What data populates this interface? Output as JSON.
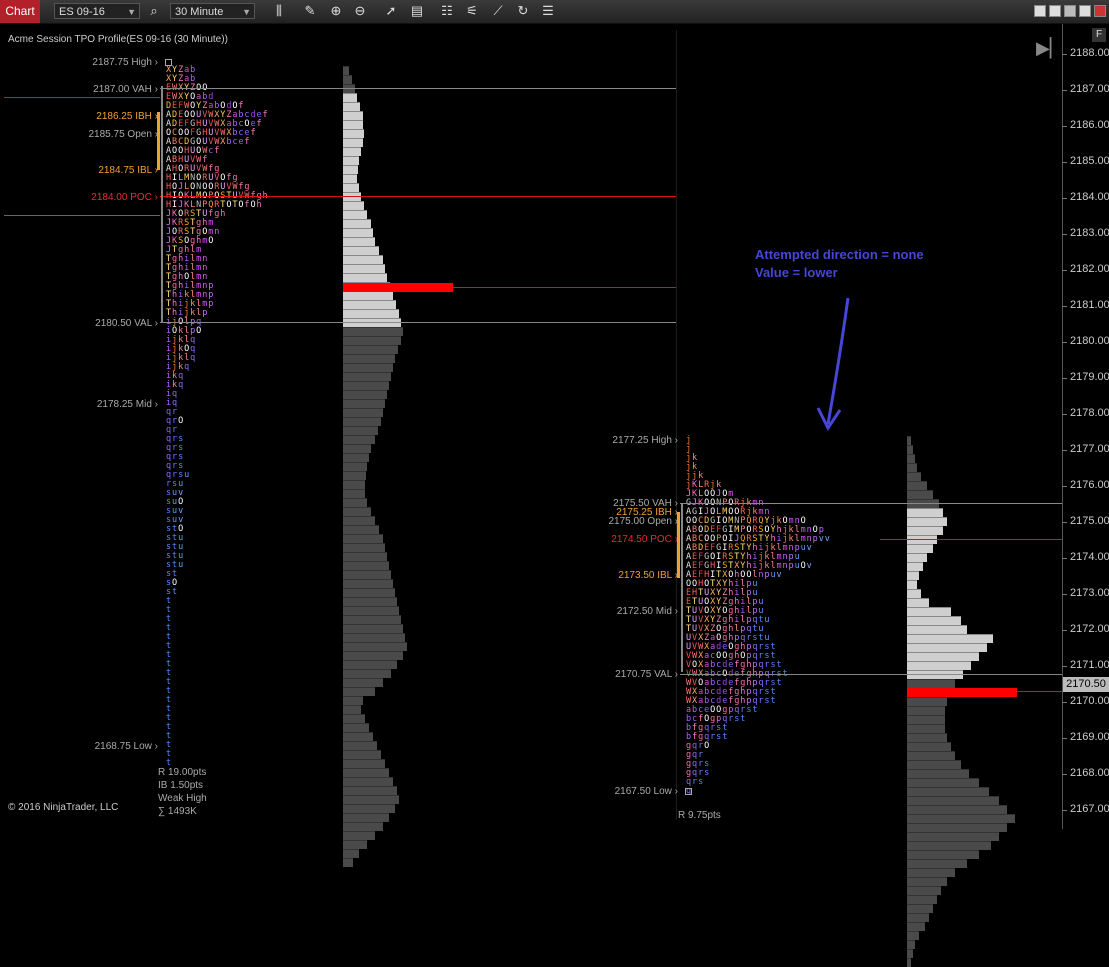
{
  "toolbar": {
    "tab_label": "Chart",
    "instrument": "ES 09-16",
    "interval": "30 Minute",
    "icons": [
      "bar-type-icon",
      "pencil-icon",
      "zoom-in-icon",
      "zoom-out-icon",
      "pointer-icon",
      "properties-icon",
      "data-box-icon",
      "indicators-icon",
      "strategies-icon",
      "refresh-icon",
      "templates-icon"
    ]
  },
  "chart": {
    "title": "Acme Session TPO Profile(ES 09-16 (30 Minute))",
    "copyright": "© 2016 NinjaTrader, LLC",
    "f_button": "F",
    "current_price": "2170.50",
    "annotation": [
      "Attempted direction = none",
      "Value = lower"
    ],
    "accent_red": "#ff0000",
    "accent_orange": "#f0a030",
    "annotation_color": "#4646d8"
  },
  "price_axis": [
    "2188.00",
    "2187.00",
    "2186.00",
    "2185.00",
    "2184.00",
    "2183.00",
    "2182.00",
    "2181.00",
    "2180.00",
    "2179.00",
    "2178.00",
    "2177.00",
    "2176.00",
    "2175.00",
    "2174.00",
    "2173.00",
    "2172.00",
    "2171.00",
    "2170.00",
    "2169.00",
    "2168.00",
    "2167.00"
  ],
  "profile1": {
    "levels": [
      {
        "text": "2187.75 High",
        "class": "",
        "price": 2187.75
      },
      {
        "text": "2187.00 VAH",
        "class": "",
        "price": 2187.0
      },
      {
        "text": "2186.25 IBH",
        "class": "orange",
        "price": 2186.25
      },
      {
        "text": "2185.75 Open",
        "class": "",
        "price": 2185.75
      },
      {
        "text": "2184.75 IBL",
        "class": "orange",
        "price": 2184.75
      },
      {
        "text": "2184.00 POC",
        "class": "red",
        "price": 2184.0
      },
      {
        "text": "2180.50 VAL",
        "class": "",
        "price": 2180.5
      },
      {
        "text": "2178.25 Mid",
        "class": "",
        "price": 2178.25
      },
      {
        "text": "2168.75 Low",
        "class": "",
        "price": 2168.75
      }
    ],
    "stats": [
      "R 19.00pts",
      "IB 1.50pts",
      "Weak High",
      "∑ 1493K"
    ],
    "tpo_rows": [
      "XYZab",
      "XYZab",
      "EWXYZOO",
      "EWXYOabd",
      "DEFWOYZabOdOf",
      "ADEOOUVWXYZabcdef",
      "ADEFGHUVWXabcOef",
      "OCOOFGHUVWXbcef",
      "ABCDGOUVWXbcef",
      "AOOHUOWcf",
      "ABHUVWf",
      "AHORUVWfg",
      "HILMNORUVOfg",
      "HOJLONOORUVWfg",
      "HIOKLMOPOSTUVWfgh",
      "HIJKLNPQRTOTOfOh",
      "JKORSTUfgh",
      "JKRSTghm",
      "JORSTgOmn",
      "JKSOghmO",
      "JTghlm",
      "Tghilmn",
      "Tghilmn",
      "TghOlmn",
      "Tghilmnp",
      "Thiklmnp",
      "Thijklmp",
      "Thijklp",
      "ijOlpq",
      "iOklpO",
      "ijklq",
      "ijkOq",
      "ijklq",
      "ijkq",
      "ikq",
      "ikq",
      "iq",
      "iq",
      "qr",
      "qrO",
      "qr",
      "qrs",
      "qrs",
      "qrs",
      "qrs",
      "qrsu",
      "rsu",
      "suv",
      "suO",
      "suv",
      "suv",
      "stO",
      "stu",
      "stu",
      "stu",
      "stu",
      "st",
      "sO",
      "st",
      "t",
      "t",
      "t",
      "t",
      "t",
      "t",
      "t",
      "t",
      "t",
      "t",
      "t",
      "t",
      "t",
      "t",
      "t",
      "t",
      "t",
      "t",
      "t"
    ],
    "histogram": [
      6,
      9,
      12,
      14,
      17,
      20,
      20,
      21,
      20,
      18,
      16,
      15,
      14,
      16,
      18,
      21,
      24,
      28,
      30,
      32,
      36,
      40,
      42,
      44,
      47,
      50,
      53,
      56,
      58,
      60,
      58,
      55,
      52,
      50,
      48,
      46,
      44,
      42,
      40,
      38,
      35,
      32,
      28,
      26,
      24,
      23,
      22,
      22,
      24,
      28,
      32,
      36,
      40,
      42,
      44,
      46,
      48,
      50,
      52,
      54,
      56,
      58,
      60,
      62,
      64,
      60,
      54,
      48,
      40,
      32,
      20,
      18,
      22,
      26,
      30,
      34,
      38,
      42,
      46,
      50,
      54,
      56,
      52,
      46,
      40,
      32,
      24,
      16,
      10
    ]
  },
  "profile2": {
    "levels": [
      {
        "text": "2177.25 High",
        "class": "",
        "price": 2177.25
      },
      {
        "text": "2175.50 VAH",
        "class": "",
        "price": 2175.5
      },
      {
        "text": "2175.25 IBH",
        "class": "orange",
        "price": 2175.25
      },
      {
        "text": "2175.00 Open",
        "class": "",
        "price": 2175.0
      },
      {
        "text": "2174.50 POC",
        "class": "red",
        "price": 2174.5
      },
      {
        "text": "2173.50 IBL",
        "class": "orange",
        "price": 2173.5
      },
      {
        "text": "2172.50 Mid",
        "class": "",
        "price": 2172.5
      },
      {
        "text": "2170.75 VAL",
        "class": "",
        "price": 2170.75
      },
      {
        "text": "2167.50 Low",
        "class": "",
        "price": 2167.5
      }
    ],
    "stats": [
      "R 9.75pts"
    ],
    "tpo_rows": [
      "j",
      "j",
      "jk",
      "jk",
      "jjk",
      "jKLRjk",
      "JKLOOJOm",
      "GJKOONPORjkmn",
      "AGIJOLMOORjkmn",
      "OOCDGIOMNPQRQYjkOmnO",
      "ABODEFGIMPORSOYhjklmnOp",
      "ABCOOPOIJQRSTYhijklmnpvv",
      "ABDEFGIRSTYhijklmnpuv",
      "AEFGOIRSTYhijklmnpu",
      "AEFGHISTXYhijklmnpuOv",
      "AEFHITXOhOOlnpuv",
      "OOHOTXYhilpu",
      "EHTUXYZhilpu",
      "ETUOXYZghilpu",
      "TUVOXYOghilpu",
      "TUVXYZghilpqtu",
      "TUVXZOghlpqtu",
      "UVXZaOghpqrstu",
      "UVWXadeOghpqrst",
      "VWXacOOghOpqrst",
      "VOXabcdefghpqrst",
      "VWXabcOdefghpqrst",
      "WVOabcdefghpqrst",
      "WXabcdefghpqrst",
      "WXabcdefghpqrst",
      "abceOOgpqrst",
      "bcfOgpqrst",
      "bfgqrst",
      "bfgqrst",
      "gqrO",
      "gqr",
      "gqrs",
      "gqrs",
      "qrs",
      "q"
    ],
    "histogram": [
      4,
      6,
      8,
      10,
      14,
      20,
      26,
      32,
      36,
      40,
      36,
      30,
      26,
      20,
      16,
      12,
      10,
      14,
      22,
      44,
      54,
      60,
      86,
      80,
      72,
      64,
      56,
      48,
      42,
      40,
      38,
      38,
      38,
      40,
      44,
      48,
      54,
      62,
      72,
      82,
      92,
      100,
      108,
      100,
      92,
      84,
      72,
      60,
      48,
      40,
      34,
      30,
      26,
      22,
      18,
      12,
      8,
      6,
      4
    ]
  }
}
